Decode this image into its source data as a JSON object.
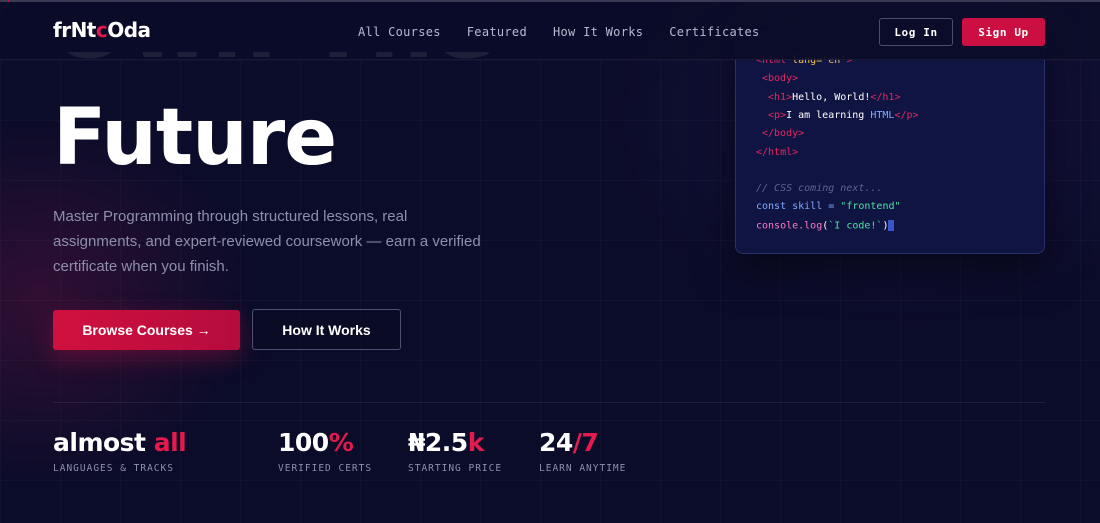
{
  "nav": {
    "logo_parts": [
      "frNt",
      "c",
      "Oda"
    ],
    "links": [
      "All Courses",
      "Featured",
      "How It Works",
      "Certificates"
    ],
    "login_label": "Log In",
    "signup_label": "Sign Up"
  },
  "hero": {
    "line1": "Own The",
    "line2": "Future",
    "description": "Master Programming through structured lessons, real assignments, and expert-reviewed coursework — earn a verified certificate when you finish.",
    "browse_label": "Browse Courses →",
    "how_label": "How It Works"
  },
  "code": {
    "l1_open": "<html ",
    "l1_attr": "lang=\"en\"",
    "l1_close": ">",
    "l2": "<body>",
    "l3_open": "<h1>",
    "l3_text": "Hello, World!",
    "l3_close": "</h1>",
    "l4_open": "<p>",
    "l4_text": "I am learning ",
    "l4_kw": "HTML",
    "l4_close": "</p>",
    "l5": "</body>",
    "l6": "</html>",
    "comment": "// CSS coming next...",
    "l8_kw": "const skill = ",
    "l8_str": "\"frontend\"",
    "l9_fn": "console.log",
    "l9_open": "(",
    "l9_str": "`I code!`",
    "l9_close": ")"
  },
  "stats": [
    {
      "value_main": "almost ",
      "value_accent": "all",
      "label": "LANGUAGES & TRACKS"
    },
    {
      "value_main": "100",
      "value_accent": "%",
      "label": "VERIFIED CERTS"
    },
    {
      "value_main": "₦2.5",
      "value_accent": "k",
      "label": "STARTING PRICE"
    },
    {
      "value_main": "24",
      "value_accent": "/7",
      "label": "LEARN ANYTIME"
    }
  ],
  "colors": {
    "accent": "#e31a4d",
    "background": "#0b0c29",
    "card": "#101442"
  }
}
